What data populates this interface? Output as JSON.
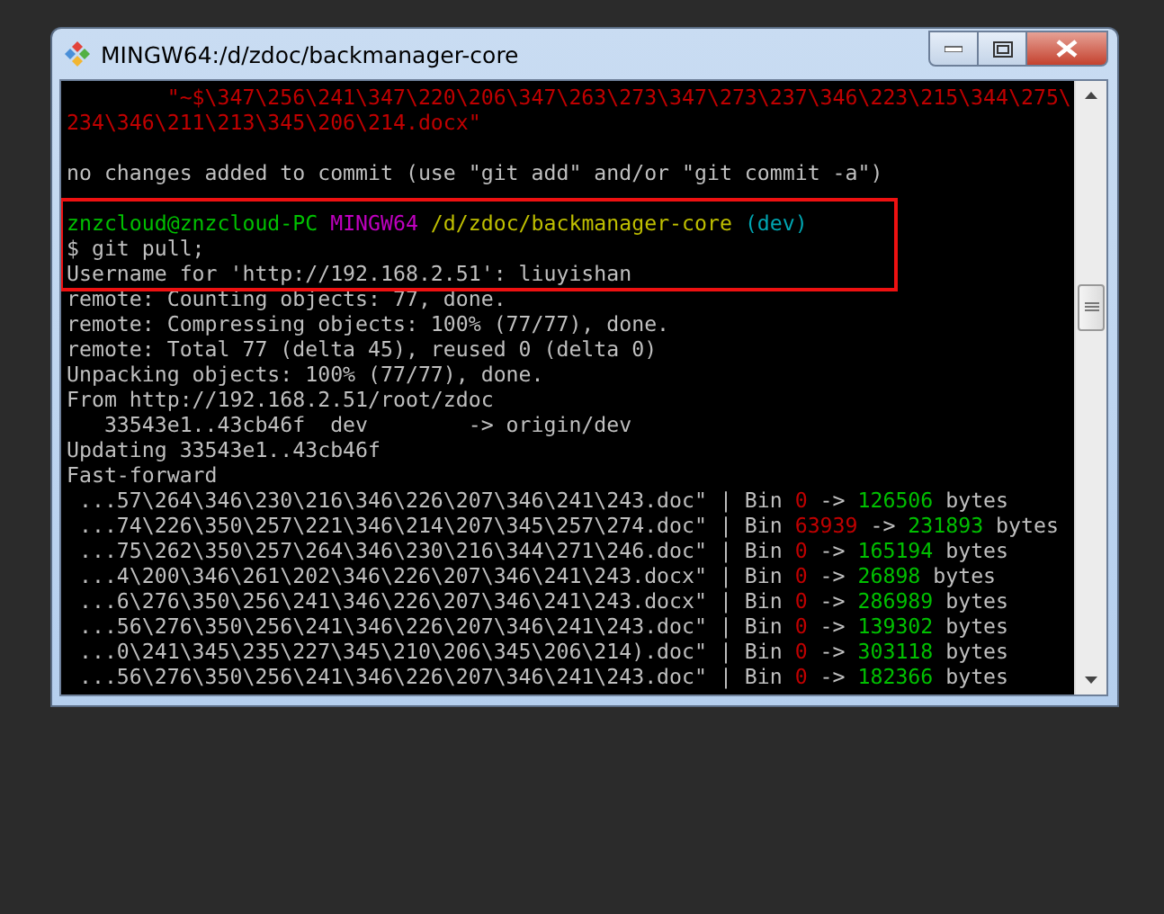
{
  "window": {
    "title": "MINGW64:/d/zdoc/backmanager-core"
  },
  "terminal": {
    "lines": [
      {
        "kind": "text",
        "highlighted": false,
        "segments": [
          {
            "kind": "error",
            "text": "        \"~$\\347\\256\\241\\347\\220\\206\\347\\263\\273\\347\\273\\237\\346\\223\\215\\344\\275\\"
          }
        ]
      },
      {
        "kind": "text",
        "highlighted": false,
        "segments": [
          {
            "kind": "error",
            "text": "234\\346\\211\\213\\345\\206\\214.docx\""
          }
        ]
      },
      {
        "kind": "blank",
        "highlighted": false
      },
      {
        "kind": "text",
        "highlighted": false,
        "segments": [
          {
            "kind": "plain",
            "text": "no changes added to commit (use \"git add\" and/or \"git commit -a\")"
          }
        ]
      },
      {
        "kind": "blank",
        "highlighted": false
      },
      {
        "kind": "text",
        "highlighted": true,
        "segments": [
          {
            "kind": "user",
            "text": "znzcloud@znzcloud-PC"
          },
          {
            "kind": "host",
            "text": " MINGW64"
          },
          {
            "kind": "path",
            "text": " /d/zdoc/backmanager-core"
          },
          {
            "kind": "branch",
            "text": " (dev)"
          }
        ]
      },
      {
        "kind": "text",
        "highlighted": true,
        "segments": [
          {
            "kind": "plain",
            "text": "$ git pull;"
          }
        ]
      },
      {
        "kind": "text",
        "highlighted": true,
        "segments": [
          {
            "kind": "plain",
            "text": "Username for 'http://192.168.2.51': liuyishan"
          }
        ]
      },
      {
        "kind": "text",
        "highlighted": false,
        "segments": [
          {
            "kind": "plain",
            "text": "remote: Counting objects: 77, done."
          }
        ]
      },
      {
        "kind": "text",
        "highlighted": false,
        "segments": [
          {
            "kind": "plain",
            "text": "remote: Compressing objects: 100% (77/77), done."
          }
        ]
      },
      {
        "kind": "text",
        "highlighted": false,
        "segments": [
          {
            "kind": "plain",
            "text": "remote: Total 77 (delta 45), reused 0 (delta 0)"
          }
        ]
      },
      {
        "kind": "text",
        "highlighted": false,
        "segments": [
          {
            "kind": "plain",
            "text": "Unpacking objects: 100% (77/77), done."
          }
        ]
      },
      {
        "kind": "text",
        "highlighted": false,
        "segments": [
          {
            "kind": "plain",
            "text": "From http://192.168.2.51/root/zdoc"
          }
        ]
      },
      {
        "kind": "text",
        "highlighted": false,
        "segments": [
          {
            "kind": "plain",
            "text": "   33543e1..43cb46f  dev        -> origin/dev"
          }
        ]
      },
      {
        "kind": "text",
        "highlighted": false,
        "segments": [
          {
            "kind": "plain",
            "text": "Updating 33543e1..43cb46f"
          }
        ]
      },
      {
        "kind": "text",
        "highlighted": false,
        "segments": [
          {
            "kind": "plain",
            "text": "Fast-forward"
          }
        ]
      },
      {
        "kind": "text",
        "highlighted": false,
        "segments": [
          {
            "kind": "plain",
            "text": " ...57\\264\\346\\230\\216\\346\\226\\207\\346\\241\\243.doc\" | Bin "
          },
          {
            "kind": "removed",
            "text": "0"
          },
          {
            "kind": "plain",
            "text": " -> "
          },
          {
            "kind": "added",
            "text": "126506"
          },
          {
            "kind": "plain",
            "text": " bytes"
          }
        ]
      },
      {
        "kind": "text",
        "highlighted": false,
        "segments": [
          {
            "kind": "plain",
            "text": " ...74\\226\\350\\257\\221\\346\\214\\207\\345\\257\\274.doc\" | Bin "
          },
          {
            "kind": "removed",
            "text": "63939"
          },
          {
            "kind": "plain",
            "text": " -> "
          },
          {
            "kind": "added",
            "text": "231893"
          },
          {
            "kind": "plain",
            "text": " bytes"
          }
        ]
      },
      {
        "kind": "text",
        "highlighted": false,
        "segments": [
          {
            "kind": "plain",
            "text": " ...75\\262\\350\\257\\264\\346\\230\\216\\344\\271\\246.doc\" | Bin "
          },
          {
            "kind": "removed",
            "text": "0"
          },
          {
            "kind": "plain",
            "text": " -> "
          },
          {
            "kind": "added",
            "text": "165194"
          },
          {
            "kind": "plain",
            "text": " bytes"
          }
        ]
      },
      {
        "kind": "text",
        "highlighted": false,
        "segments": [
          {
            "kind": "plain",
            "text": " ...4\\200\\346\\261\\202\\346\\226\\207\\346\\241\\243.docx\" | Bin "
          },
          {
            "kind": "removed",
            "text": "0"
          },
          {
            "kind": "plain",
            "text": " -> "
          },
          {
            "kind": "added",
            "text": "26898"
          },
          {
            "kind": "plain",
            "text": " bytes"
          }
        ]
      },
      {
        "kind": "text",
        "highlighted": false,
        "segments": [
          {
            "kind": "plain",
            "text": " ...6\\276\\350\\256\\241\\346\\226\\207\\346\\241\\243.docx\" | Bin "
          },
          {
            "kind": "removed",
            "text": "0"
          },
          {
            "kind": "plain",
            "text": " -> "
          },
          {
            "kind": "added",
            "text": "286989"
          },
          {
            "kind": "plain",
            "text": " bytes"
          }
        ]
      },
      {
        "kind": "text",
        "highlighted": false,
        "segments": [
          {
            "kind": "plain",
            "text": " ...56\\276\\350\\256\\241\\346\\226\\207\\346\\241\\243.doc\" | Bin "
          },
          {
            "kind": "removed",
            "text": "0"
          },
          {
            "kind": "plain",
            "text": " -> "
          },
          {
            "kind": "added",
            "text": "139302"
          },
          {
            "kind": "plain",
            "text": " bytes"
          }
        ]
      },
      {
        "kind": "text",
        "highlighted": false,
        "segments": [
          {
            "kind": "plain",
            "text": " ...0\\241\\345\\235\\227\\345\\210\\206\\345\\206\\214).doc\" | Bin "
          },
          {
            "kind": "removed",
            "text": "0"
          },
          {
            "kind": "plain",
            "text": " -> "
          },
          {
            "kind": "added",
            "text": "303118"
          },
          {
            "kind": "plain",
            "text": " bytes"
          }
        ]
      },
      {
        "kind": "text",
        "highlighted": false,
        "segments": [
          {
            "kind": "plain",
            "text": " ...56\\276\\350\\256\\241\\346\\226\\207\\346\\241\\243.doc\" | Bin "
          },
          {
            "kind": "removed",
            "text": "0"
          },
          {
            "kind": "plain",
            "text": " -> "
          },
          {
            "kind": "added",
            "text": "182366"
          },
          {
            "kind": "plain",
            "text": " bytes"
          }
        ]
      }
    ]
  }
}
